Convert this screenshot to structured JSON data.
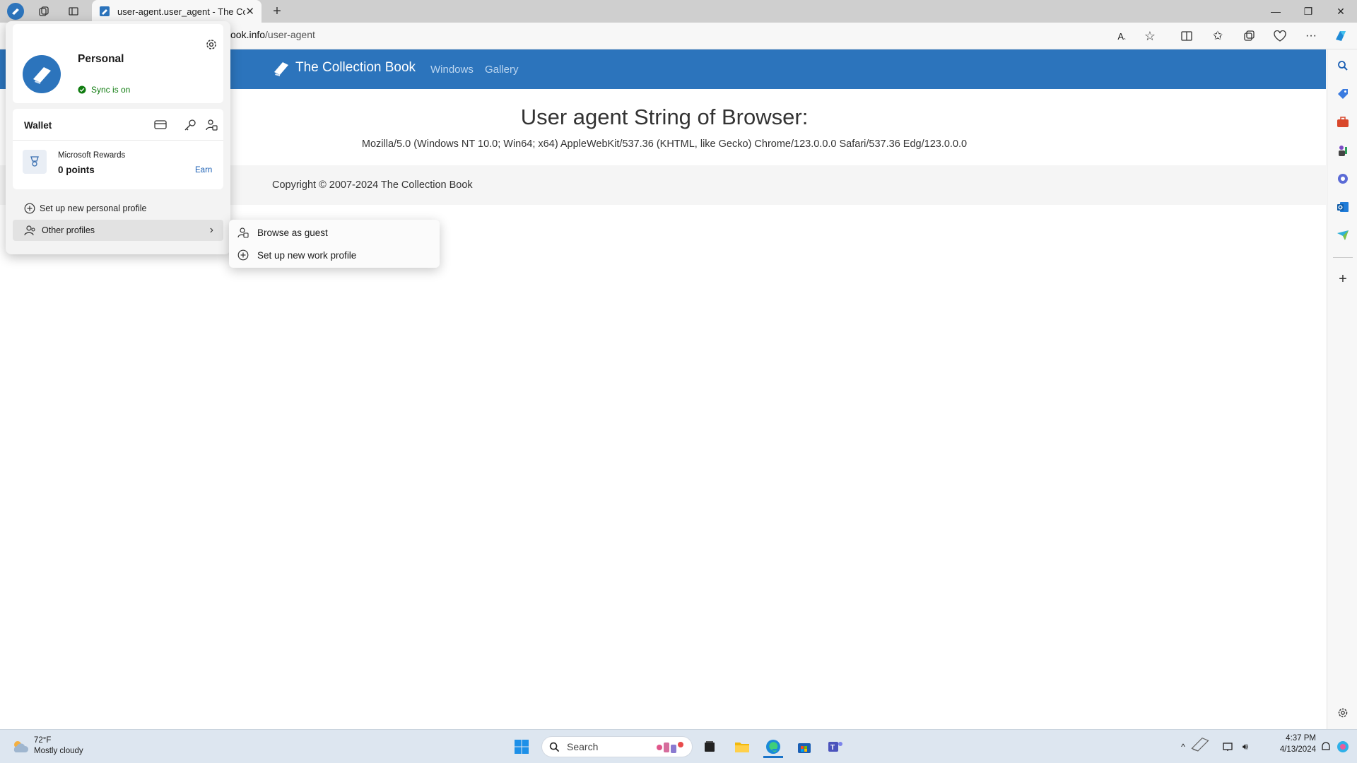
{
  "tab": {
    "title": "user-agent.user_agent - The Coll"
  },
  "address": {
    "host": "ook.info",
    "path": "/user-agent"
  },
  "site": {
    "brand": "The Collection Book",
    "nav": [
      "Windows",
      "Gallery"
    ],
    "heading": "User agent String of Browser:",
    "user_agent": "Mozilla/5.0 (Windows NT 10.0; Win64; x64) AppleWebKit/537.36 (KHTML, like Gecko) Chrome/123.0.0.0 Safari/537.36 Edg/123.0.0.0",
    "copyright": "Copyright © 2007-2024 The Collection Book"
  },
  "profile": {
    "name": "Personal",
    "sync": "Sync is on",
    "wallet_label": "Wallet",
    "rewards_label": "Microsoft Rewards",
    "points": "0 points",
    "earn": "Earn",
    "setup_personal": "Set up new personal profile",
    "other_profiles": "Other profiles"
  },
  "submenu": {
    "guest": "Browse as guest",
    "work": "Set up new work profile"
  },
  "taskbar": {
    "temp": "72°F",
    "condition": "Mostly cloudy",
    "search": "Search",
    "time": "4:37 PM",
    "date": "4/13/2024"
  },
  "colors": {
    "brand": "#2c74bc",
    "sync": "#107c10"
  }
}
